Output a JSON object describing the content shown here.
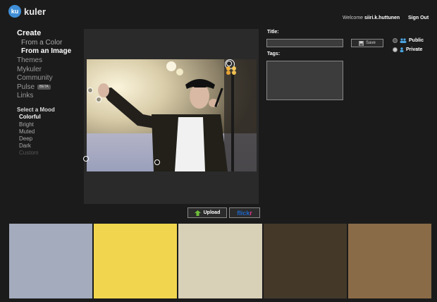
{
  "header": {
    "logo_badge": "ku",
    "logo_text": "kuler",
    "welcome_prefix": "Welcome",
    "username": "siiri.k.huttunen",
    "sign_out": "Sign Out"
  },
  "nav": {
    "create": "Create",
    "create_items": [
      "From a Color",
      "From an Image"
    ],
    "main_items": [
      "Themes",
      "Mykuler",
      "Community",
      "Pulse",
      "Links"
    ],
    "pulse_badge": "BETA"
  },
  "mood": {
    "title": "Select a Mood",
    "items": [
      "Colorful",
      "Bright",
      "Muted",
      "Deep",
      "Dark",
      "Custom"
    ]
  },
  "actions": {
    "upload_label": "Upload"
  },
  "form": {
    "title_label": "Title:",
    "title_value": "",
    "tags_label": "Tags:",
    "tags_value": "",
    "save_label": "Save",
    "public_label": "Public",
    "private_label": "Private"
  },
  "palette": {
    "colors": [
      "#a3abbd",
      "#f2d54f",
      "#d8d0b7",
      "#443829",
      "#8a6b47"
    ]
  }
}
